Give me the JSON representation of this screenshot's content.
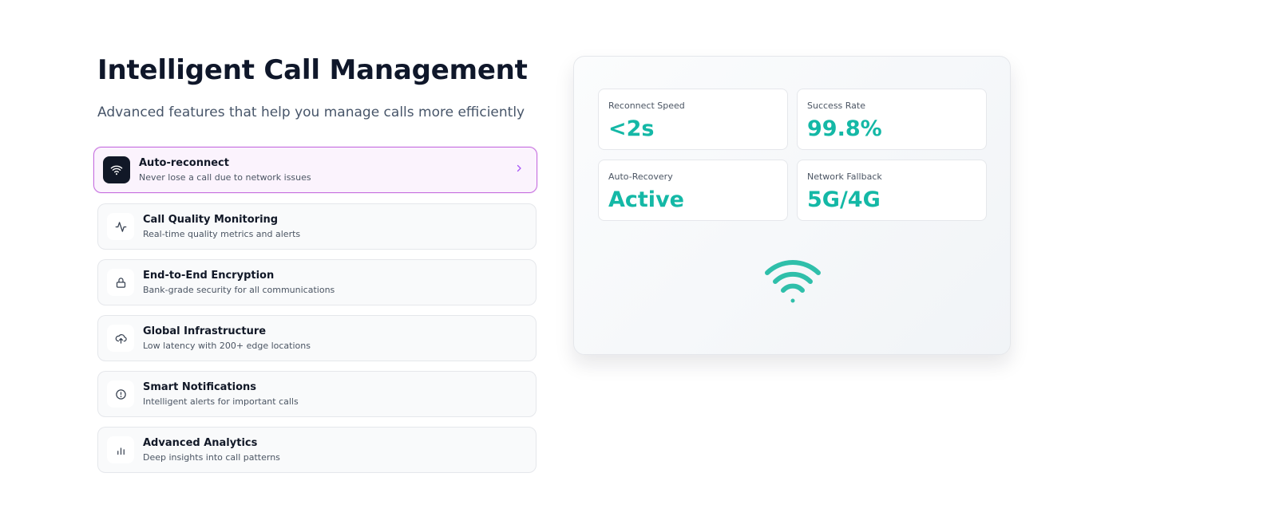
{
  "header": {
    "title": "Intelligent Call Management",
    "subtitle": "Advanced features that help you manage calls more efficiently"
  },
  "features": [
    {
      "title": "Auto-reconnect",
      "description": "Never lose a call due to network issues",
      "icon": "wifi-icon",
      "active": true
    },
    {
      "title": "Call Quality Monitoring",
      "description": "Real-time quality metrics and alerts",
      "icon": "activity-icon",
      "active": false
    },
    {
      "title": "End-to-End Encryption",
      "description": "Bank-grade security for all communications",
      "icon": "lock-icon",
      "active": false
    },
    {
      "title": "Global Infrastructure",
      "description": "Low latency with 200+ edge locations",
      "icon": "cloud-upload-icon",
      "active": false
    },
    {
      "title": "Smart Notifications",
      "description": "Intelligent alerts for important calls",
      "icon": "alert-circle-icon",
      "active": false
    },
    {
      "title": "Advanced Analytics",
      "description": "Deep insights into call patterns",
      "icon": "bar-chart-icon",
      "active": false
    }
  ],
  "panel": {
    "stats": [
      {
        "label": "Reconnect Speed",
        "value": "<2s"
      },
      {
        "label": "Success Rate",
        "value": "99.8%"
      },
      {
        "label": "Auto-Recovery",
        "value": "Active"
      },
      {
        "label": "Network Fallback",
        "value": "5G/4G"
      }
    ],
    "icon": "wifi-icon"
  },
  "colors": {
    "accent": "#14b8a6",
    "active_border": "#c66fe0",
    "active_bg": "#fbf3fd",
    "heading": "#0f172a"
  }
}
